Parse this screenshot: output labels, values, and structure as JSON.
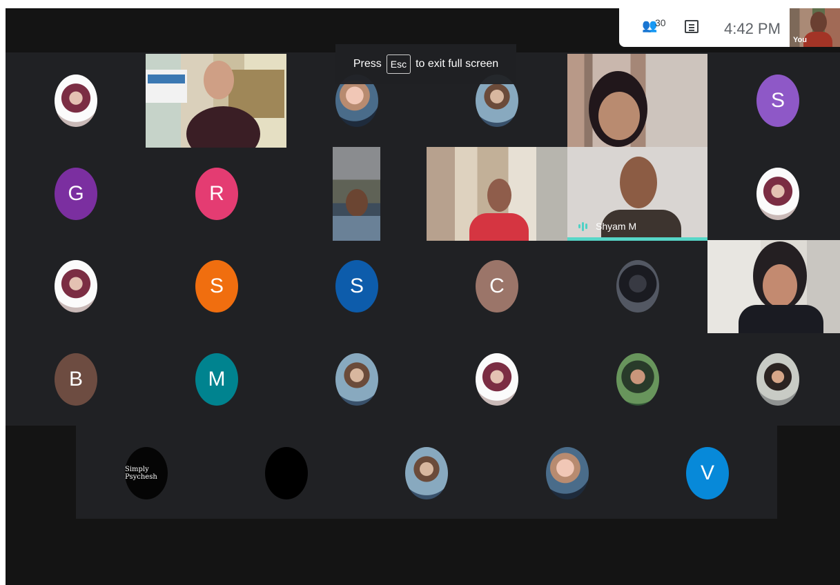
{
  "toast": {
    "press": "Press",
    "key": "Esc",
    "message": "to exit full screen"
  },
  "top_bar": {
    "participant_count": "30",
    "time": "4:42 PM",
    "self_label": "You",
    "people_icon": "people-icon",
    "chat_icon": "chat-icon"
  },
  "participants": {
    "letter_avatars": [
      {
        "initial": "S",
        "color": "#8e58c7"
      },
      {
        "initial": "G",
        "color": "#7b2fa0"
      },
      {
        "initial": "R",
        "color": "#e43c72"
      },
      {
        "initial": "S",
        "color": "#f06e0f"
      },
      {
        "initial": "S",
        "color": "#0d5cab"
      },
      {
        "initial": "C",
        "color": "#9b7569"
      },
      {
        "initial": "B",
        "color": "#6d4c41"
      },
      {
        "initial": "M",
        "color": "#00838f"
      },
      {
        "initial": "V",
        "color": "#0789d9"
      }
    ],
    "speaker": "Shyam M",
    "speaker_accent": "#57d6c7",
    "signature_text": "Simply Psychesh"
  }
}
